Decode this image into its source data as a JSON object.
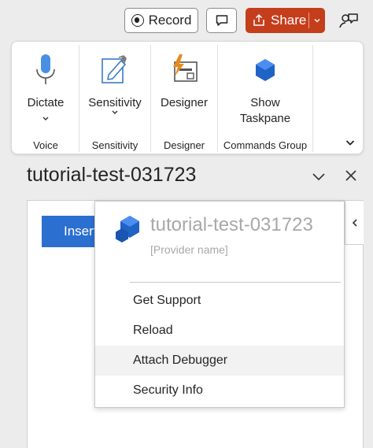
{
  "topbar": {
    "record_label": "Record",
    "share_label": "Share",
    "icons": {
      "record": "record-icon",
      "comment": "comment-icon",
      "share": "share-icon",
      "dropdown": "chevron-down-icon",
      "coauthor": "coauthoring-icon"
    }
  },
  "ribbon": {
    "groups": [
      {
        "name": "Voice",
        "button_label": "Dictate",
        "icon": "microphone-icon",
        "has_dropdown": true
      },
      {
        "name": "Sensitivity",
        "button_label": "Sensitivity",
        "icon": "sensitivity-icon",
        "has_dropdown": true
      },
      {
        "name": "Designer",
        "button_label": "Designer",
        "icon": "designer-icon",
        "has_dropdown": false
      },
      {
        "name": "Commands Group",
        "button_label_line1": "Show",
        "button_label_line2": "Taskpane",
        "icon": "add-in-icon",
        "has_dropdown": false
      }
    ],
    "more_icon": "chevron-down-icon"
  },
  "taskpane": {
    "title": "tutorial-test-031723",
    "insert_button_label": "Insert"
  },
  "callout": {
    "addin_title": "tutorial-test-031723",
    "provider_placeholder": "[Provider name]",
    "menu_items": [
      {
        "label": "Get Support"
      },
      {
        "label": "Reload"
      },
      {
        "label": "Attach Debugger",
        "highlighted": true
      },
      {
        "label": "Security Info"
      }
    ]
  },
  "colors": {
    "share_button": "#c43e1c",
    "insert_button": "#2b6fd1",
    "addin_logo": "#2b6fd1",
    "microphone": "#4a90e2",
    "designer_bolt": "#e8891d"
  }
}
